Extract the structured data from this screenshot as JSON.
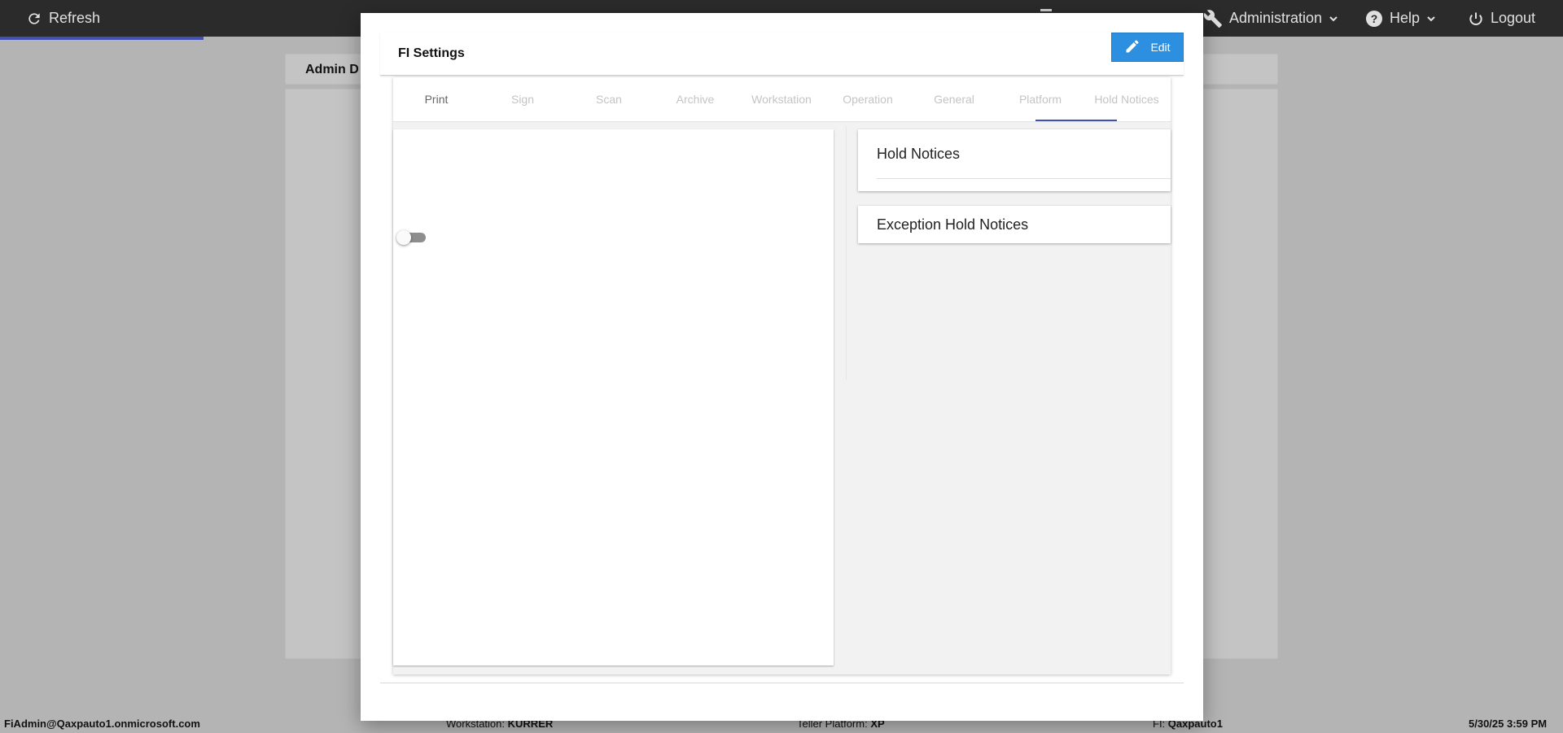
{
  "topbar": {
    "refresh_label": "Refresh",
    "administration_label": "Administration",
    "help_label": "Help",
    "logout_label": "Logout"
  },
  "background": {
    "page_title_partial": "Admin D"
  },
  "modal": {
    "title": "FI Settings",
    "edit_label": "Edit",
    "tabs": [
      {
        "label": "Print"
      },
      {
        "label": "Sign"
      },
      {
        "label": "Scan"
      },
      {
        "label": "Archive"
      },
      {
        "label": "Workstation"
      },
      {
        "label": "Operation"
      },
      {
        "label": "General"
      },
      {
        "label": "Platform"
      },
      {
        "label": "Hold Notices"
      }
    ],
    "active_tab": "Hold Notices",
    "sections": [
      {
        "title": "Hold Notices"
      },
      {
        "title": "Exception Hold Notices"
      }
    ],
    "toggle_on": false
  },
  "statusbar": {
    "user": "FiAdmin@Qaxpauto1.onmicrosoft.com",
    "workstation_label": "Workstation:",
    "workstation_value": "KURRER",
    "teller_label": "Teller Platform:",
    "teller_value": "XP",
    "fi_label": "FI:",
    "fi_value": "Qaxpauto1",
    "datetime": "5/30/25 3:59 PM"
  },
  "colors": {
    "accent": "#3f51b5",
    "edit_button": "#2d8fe0",
    "topbar": "#2b2b2b"
  }
}
